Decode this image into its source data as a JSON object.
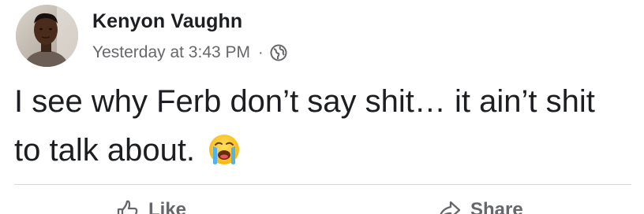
{
  "post": {
    "author_name": "Kenyon Vaughn",
    "timestamp": "Yesterday at 3:43 PM",
    "separator": "·",
    "audience_icon": "globe-icon",
    "text": "I see why Ferb don’t say shit… it ain’t shit to talk about.",
    "emoji": "loudly-crying-face-emoji"
  },
  "actions": {
    "like_label": "Like",
    "share_label": "Share",
    "like_icon": "thumbs-up-icon",
    "share_icon": "share-arrow-icon"
  },
  "colors": {
    "text_primary": "#1c1e21",
    "text_secondary": "#65676b",
    "divider": "#d7d9dd"
  }
}
